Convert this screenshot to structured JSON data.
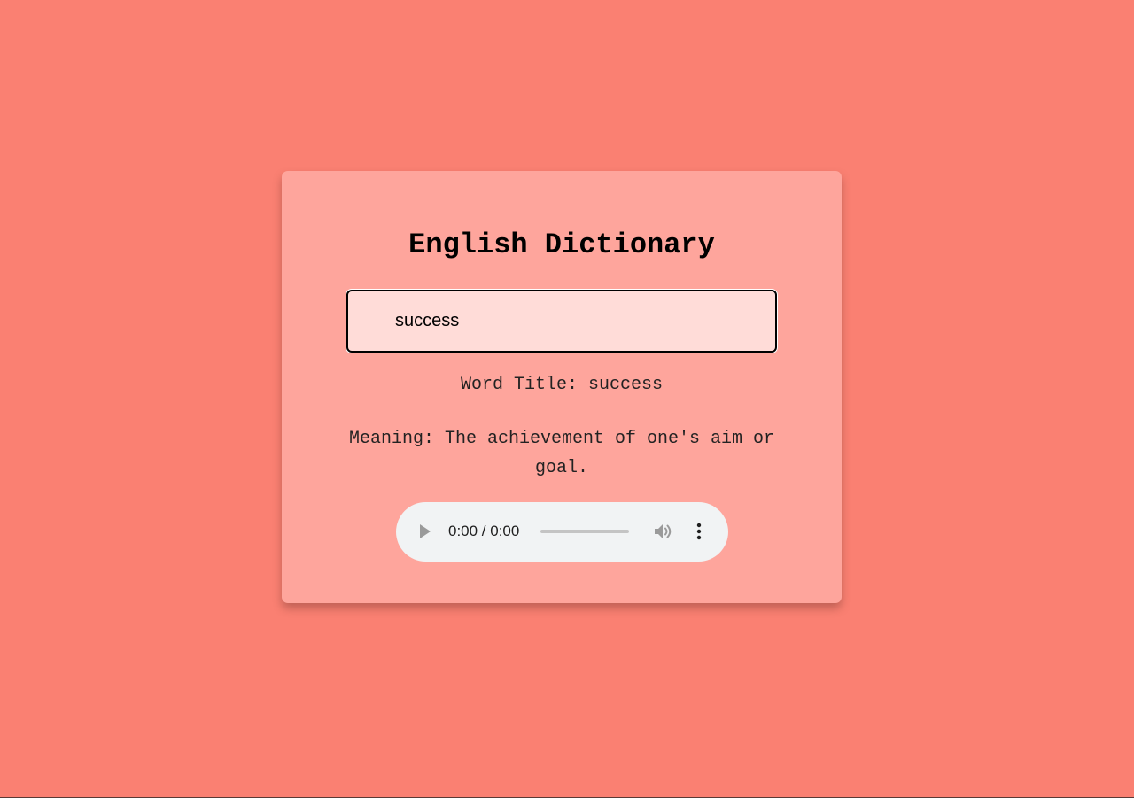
{
  "header": {
    "title": "English Dictionary"
  },
  "search": {
    "value": "success",
    "placeholder": ""
  },
  "result": {
    "word_title": "Word Title: success",
    "meaning": "Meaning: The achievement of one's aim or goal."
  },
  "audio_player": {
    "time_display": "0:00 / 0:00",
    "progress": 0,
    "icons": {
      "play": "play-icon",
      "volume": "volume-icon",
      "menu": "more-vert-icon"
    }
  },
  "colors": {
    "page_background": "#fa8072",
    "card_background": "#fea59c",
    "input_background": "#ffdcd8",
    "player_background": "#f1f3f4"
  }
}
